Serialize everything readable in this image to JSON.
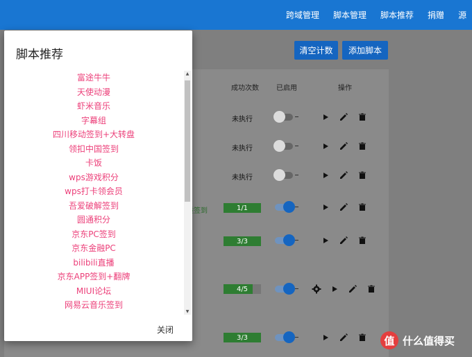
{
  "topnav": {
    "items": [
      "跨域管理",
      "脚本管理",
      "脚本推荐",
      "捐赠",
      "源"
    ]
  },
  "toolbar": {
    "clear_label": "清空计数",
    "add_label": "添加脚本"
  },
  "table": {
    "headers": {
      "success": "成功次数",
      "enabled": "已启用",
      "actions": "操作"
    },
    "rows": [
      {
        "count": "未执行",
        "enabled": false
      },
      {
        "count": "未执行",
        "enabled": false
      },
      {
        "count": "未执行",
        "enabled": false
      },
      {
        "count": "1/1",
        "enabled": true,
        "label": "碰签到"
      },
      {
        "count": "3/3",
        "enabled": true
      },
      {
        "count": "4/5",
        "enabled": true
      },
      {
        "count": "3/3",
        "enabled": true
      }
    ]
  },
  "dialog": {
    "title": "脚本推荐",
    "items": [
      "富途牛牛",
      "天使动漫",
      "虾米音乐",
      "字幕组",
      "四川移动签到+大转盘",
      "领扣中国签到",
      "卡饭",
      "wps游戏积分",
      "wps打卡领会员",
      "吾爱破解签到",
      "圆通积分",
      "京东PC签到",
      "京东金融PC",
      "bilibili直播",
      "京东APP签到+翻牌",
      "MIUI论坛",
      "网易云音乐签到"
    ],
    "close_label": "关闭"
  },
  "watermark": {
    "badge": "值",
    "text": "什么值得买"
  }
}
